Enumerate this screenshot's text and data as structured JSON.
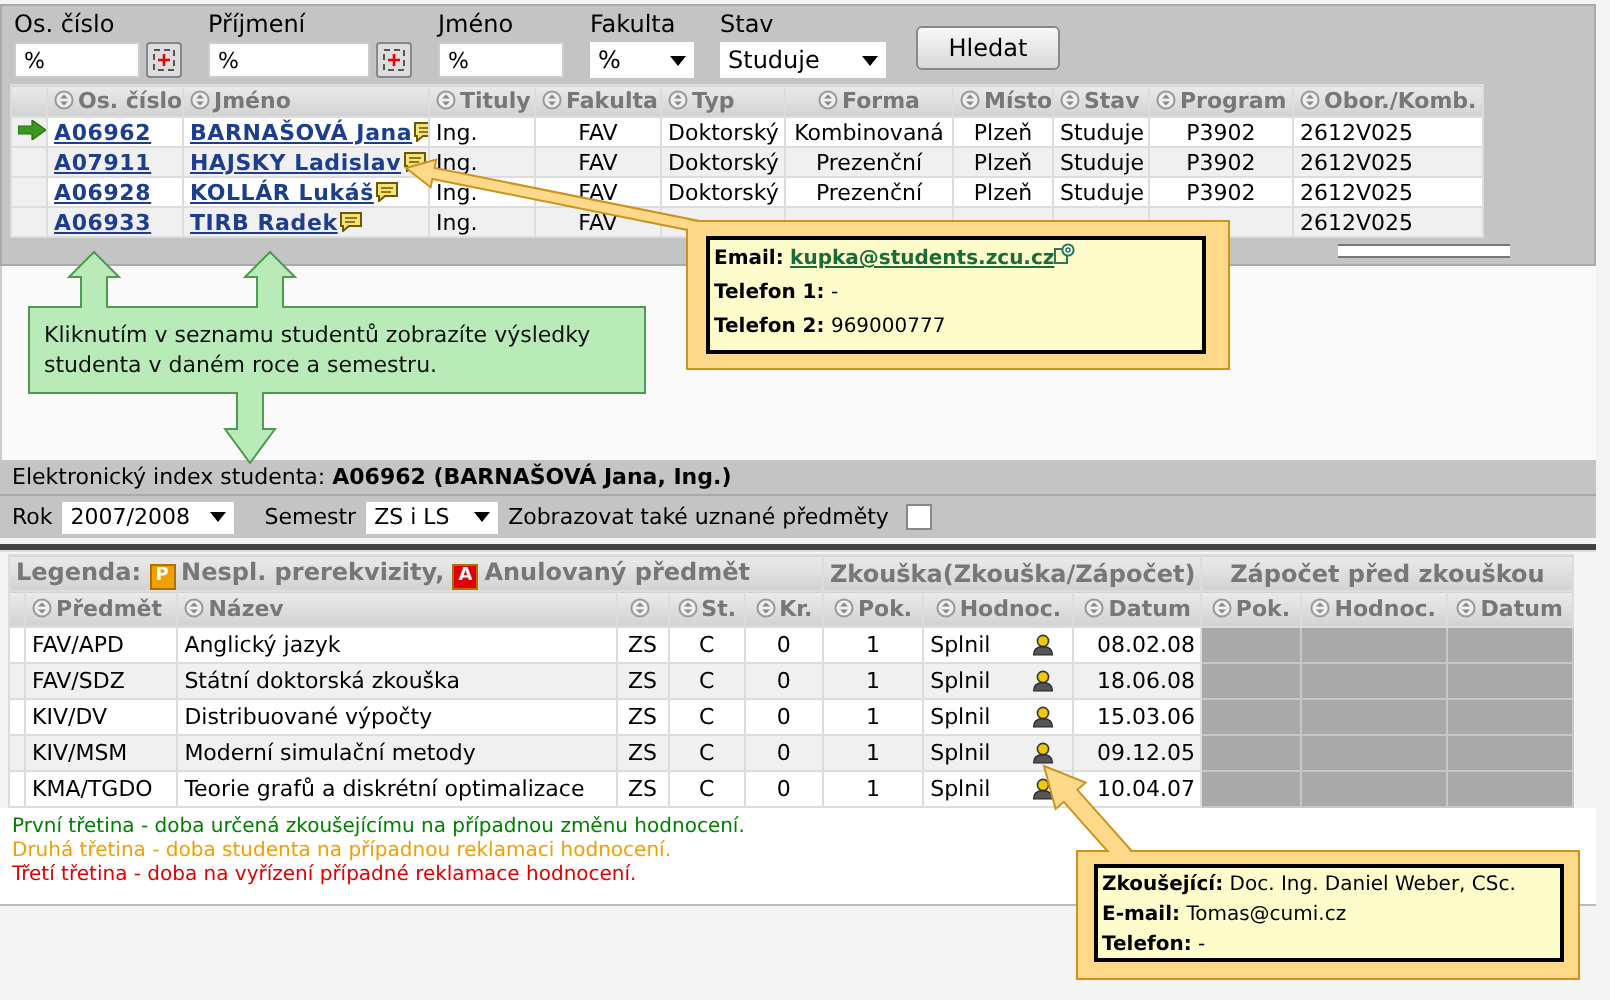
{
  "filters": [
    {
      "label": "Os. číslo",
      "kind": "pick",
      "value": "%"
    },
    {
      "label": "Příjmení",
      "kind": "pick",
      "value": "%"
    },
    {
      "label": "Jméno",
      "kind": "text",
      "value": "%"
    },
    {
      "label": "Fakulta",
      "kind": "select",
      "value": "%"
    },
    {
      "label": "Stav",
      "kind": "select",
      "value": "Studuje"
    }
  ],
  "search_button": "Hledat",
  "students": {
    "columns": [
      {
        "label": "Os. číslo",
        "sortable": true
      },
      {
        "label": "Jméno",
        "sortable": true
      },
      {
        "label": "Tituly",
        "sortable": true
      },
      {
        "label": "Fakulta",
        "sortable": true
      },
      {
        "label": "Typ",
        "sortable": true
      },
      {
        "label": "Forma",
        "sortable": true
      },
      {
        "label": "Místo",
        "sortable": true
      },
      {
        "label": "Stav",
        "sortable": true
      },
      {
        "label": "Program",
        "sortable": true
      },
      {
        "label": "Obor./Komb.",
        "sortable": true
      }
    ],
    "rows": [
      {
        "selected": true,
        "id": "A06962",
        "name": "BARNAŠOVÁ Jana",
        "tituly": "Ing.",
        "fakulta": "FAV",
        "typ": "Doktorský",
        "forma": "Kombinovaná",
        "misto": "Plzeň",
        "stav": "Studuje",
        "program": "P3902",
        "obor": "2612V025"
      },
      {
        "selected": false,
        "id": "A07911",
        "name": "HAJSKY Ladislav",
        "tituly": "Ing.",
        "fakulta": "FAV",
        "typ": "Doktorský",
        "forma": "Prezenční",
        "misto": "Plzeň",
        "stav": "Studuje",
        "program": "P3902",
        "obor": "2612V025"
      },
      {
        "selected": false,
        "id": "A06928",
        "name": "KOLLÁR Lukáš",
        "tituly": "Ing.",
        "fakulta": "FAV",
        "typ": "Doktorský",
        "forma": "Prezenční",
        "misto": "Plzeň",
        "stav": "Studuje",
        "program": "P3902",
        "obor": "2612V025"
      },
      {
        "selected": false,
        "id": "A06933",
        "name": "TIRB Radek",
        "tituly": "Ing.",
        "fakulta": "FAV",
        "obor": "2612V025"
      }
    ]
  },
  "hint_callout": "Kliknutím v seznamu studentů zobrazíte výsledky studenta v daném roce a semestru.",
  "email_callout": {
    "email_label": "Email:",
    "email": "kupka@students.zcu.cz",
    "phone1_label": "Telefon 1:",
    "phone1": "-",
    "phone2_label": "Telefon 2:",
    "phone2": "969000777"
  },
  "index_bar": {
    "label": "Elektronický index studenta:",
    "student": "A06962 (BARNAŠOVÁ Jana, Ing.)"
  },
  "options": {
    "year_label": "Rok",
    "year": "2007/2008",
    "semester_label": "Semestr",
    "semester": "ZS i LS",
    "recognized_label": "Zobrazovat také uznané předměty",
    "recognized_checked": false
  },
  "results": {
    "legend_label": "Legenda:",
    "legend": [
      {
        "badge": "P",
        "text": "Nespl. prerekvizity,",
        "color": "#f0a000"
      },
      {
        "badge": "A",
        "text": "Anulovaný předmět",
        "color": "#e00000"
      }
    ],
    "groups": [
      "Zkouška(Zkouška/Zápočet)",
      "Zápočet před zkouškou"
    ],
    "columns": [
      {
        "label": "Předmět",
        "sortable": true
      },
      {
        "label": "Název",
        "sortable": true
      },
      {
        "sortable": true
      },
      {
        "label": "St.",
        "sortable": true
      },
      {
        "label": "Kr.",
        "sortable": true
      },
      {
        "label": "Pok.",
        "sortable": true
      },
      {
        "label": "Hodnoc.",
        "sortable": true
      },
      {
        "label": "Datum",
        "sortable": true
      },
      {
        "label": "Pok.",
        "sortable": true
      },
      {
        "label": "Hodnoc.",
        "sortable": true
      },
      {
        "label": "Datum",
        "sortable": true
      }
    ],
    "rows": [
      {
        "code": "FAV/APD",
        "name": "Anglický jazyk",
        "sem": "ZS",
        "st": "C",
        "kr": "0",
        "pok": "1",
        "grade": "Splnil",
        "date": "08.02.08"
      },
      {
        "code": "FAV/SDZ",
        "name": "Státní doktorská zkouška",
        "sem": "ZS",
        "st": "C",
        "kr": "0",
        "pok": "1",
        "grade": "Splnil",
        "date": "18.06.08"
      },
      {
        "code": "KIV/DV",
        "name": "Distribuované výpočty",
        "sem": "ZS",
        "st": "C",
        "kr": "0",
        "pok": "1",
        "grade": "Splnil",
        "date": "15.03.06"
      },
      {
        "code": "KIV/MSM",
        "name": "Moderní simulační metody",
        "sem": "ZS",
        "st": "C",
        "kr": "0",
        "pok": "1",
        "grade": "Splnil",
        "date": "09.12.05"
      },
      {
        "code": "KMA/TGDO",
        "name": "Teorie grafů a diskrétní optimalizace",
        "sem": "ZS",
        "st": "C",
        "kr": "0",
        "pok": "1",
        "grade": "Splnil",
        "date": "10.04.07"
      }
    ]
  },
  "notes": [
    {
      "text": "První třetina - doba určená zkoušejícímu na případnou změnu hodnocení.",
      "color": "#008000"
    },
    {
      "text": "Druhá třetina - doba studenta na případnou reklamaci hodnocení.",
      "color": "#f0a000"
    },
    {
      "text": "Třetí třetina - doba na vyřízení případné reklamace hodnocení.",
      "color": "#e00000"
    }
  ],
  "examiner_callout": {
    "examiner_label": "Zkoušející:",
    "examiner": "Doc. Ing. Daniel Weber, CSc.",
    "email_label": "E-mail:",
    "email": "Tomas@cumi.cz",
    "phone_label": "Telefon:",
    "phone": "-"
  }
}
